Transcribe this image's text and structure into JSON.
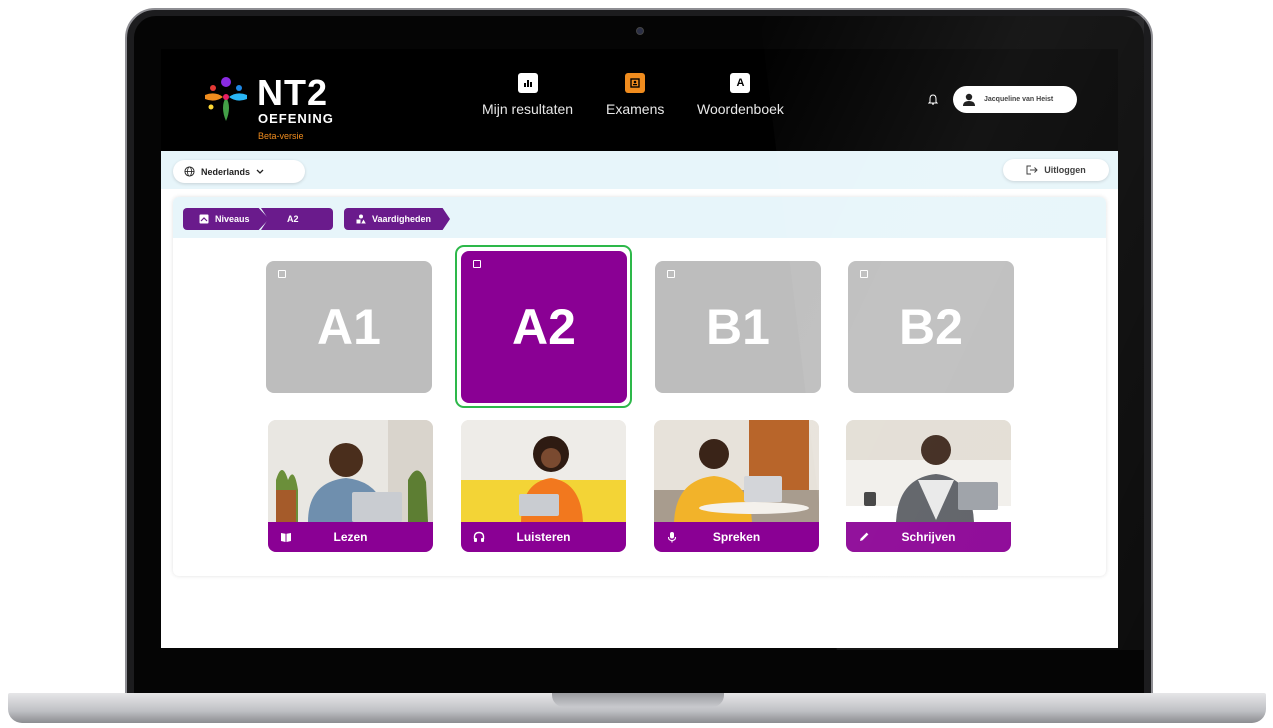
{
  "app": {
    "logo_title": "NT2",
    "logo_subtitle": "OEFENING",
    "logo_badge": "Beta-versie"
  },
  "header": {
    "nav": [
      {
        "label": "Mijn resultaten",
        "icon": "chart-icon",
        "active": false
      },
      {
        "label": "Examens",
        "icon": "exam-icon",
        "active": true
      },
      {
        "label": "Woordenboek",
        "icon": "dictionary-icon",
        "active": false
      }
    ],
    "user_name": "Jacqueline van Heist"
  },
  "subbar": {
    "language": "Nederlands",
    "logout_label": "Uitloggen"
  },
  "breadcrumb": {
    "items": [
      "Niveaus",
      "A2",
      "Vaardigheden"
    ]
  },
  "levels": [
    {
      "label": "A1",
      "selected": false
    },
    {
      "label": "A2",
      "selected": true
    },
    {
      "label": "B1",
      "selected": false
    },
    {
      "label": "B2",
      "selected": false
    }
  ],
  "skills": [
    {
      "label": "Lezen",
      "icon": "book-icon"
    },
    {
      "label": "Luisteren",
      "icon": "headphones-icon"
    },
    {
      "label": "Spreken",
      "icon": "microphone-icon"
    },
    {
      "label": "Schrijven",
      "icon": "pencil-icon"
    }
  ],
  "colors": {
    "brand_purple": "#8a0094",
    "breadcrumb_purple": "#6a1b8c",
    "selected_ring": "#2db84a",
    "accent_orange": "#f08c1e",
    "inactive_tile": "#bdbdbd"
  }
}
